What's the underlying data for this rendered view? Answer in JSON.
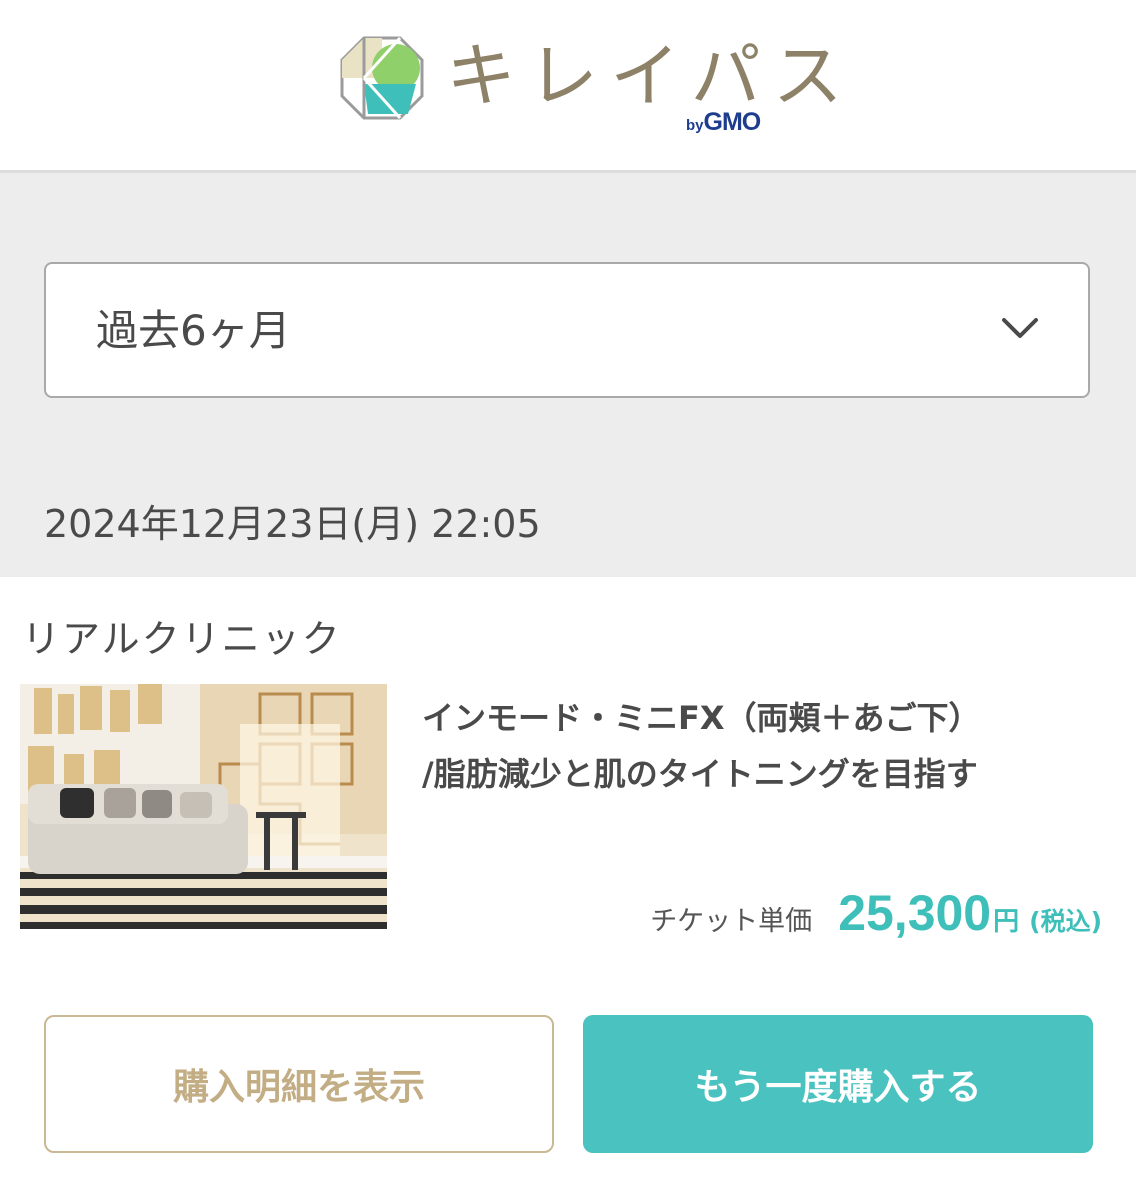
{
  "header": {
    "logo_text": "キレイパス",
    "logo_by": "by",
    "logo_brand": "GMO"
  },
  "filter": {
    "period_label": "過去6ヶ月"
  },
  "order": {
    "datetime": "2024年12月23日(月) 22:05",
    "clinic_name": "リアルクリニック",
    "menu_title_line1": "インモード・ミニFX（両頬＋あご下）",
    "menu_title_line2": "/脂肪減少と肌のタイトニングを目指す",
    "price_label": "チケット単価",
    "price_value": "25,300",
    "price_unit": "円",
    "price_tax": "(税込)"
  },
  "buttons": {
    "detail_label": "購入明細を表示",
    "rebuy_label": "もう一度購入する"
  },
  "icons": {
    "logo": "kireipass-logo-icon",
    "dropdown": "chevron-down-icon"
  },
  "colors": {
    "brand_teal": "#4ac2bf",
    "price_teal": "#3fbfb9",
    "brand_gold": "#c9b894",
    "logo_text": "#8d8168",
    "band_gray": "#ededed"
  }
}
